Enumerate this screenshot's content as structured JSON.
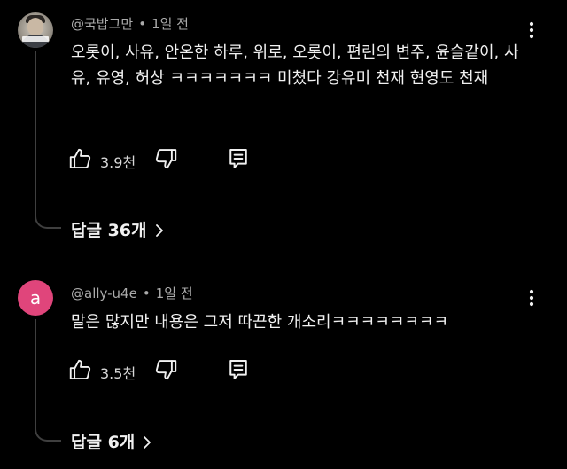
{
  "comments": [
    {
      "author": "@국밥그만",
      "time": "1일 전",
      "text": "오롯이, 사유, 안온한 하루, 위로, 오롯이, 편린의 변주, 윤슬같이, 사유, 유영, 허상 ㅋㅋㅋㅋㅋㅋㅋ 미쳤다 강유미 천재 현영도 천재",
      "likes": "3.9천",
      "replies_label": "답글 36개",
      "avatar_type": "photo"
    },
    {
      "author": "@ally-u4e",
      "time": "1일 전",
      "text": "말은 많지만 내용은 그저 따끈한 개소리ㅋㅋㅋㅋㅋㅋㅋㅋ",
      "likes": "3.5천",
      "replies_label": "답글 6개",
      "avatar_type": "letter",
      "avatar_letter": "a",
      "avatar_color": "#e0457b"
    }
  ],
  "separator": "•",
  "colors": {
    "background": "#000000",
    "text": "#f1f1f1",
    "meta": "#aaaaaa",
    "thread_line": "#3f3f3f"
  },
  "icons": {
    "more": "more-vert-icon",
    "like": "thumbs-up-icon",
    "dislike": "thumbs-down-icon",
    "reply": "reply-comment-icon",
    "expand": "chevron-right-icon"
  }
}
